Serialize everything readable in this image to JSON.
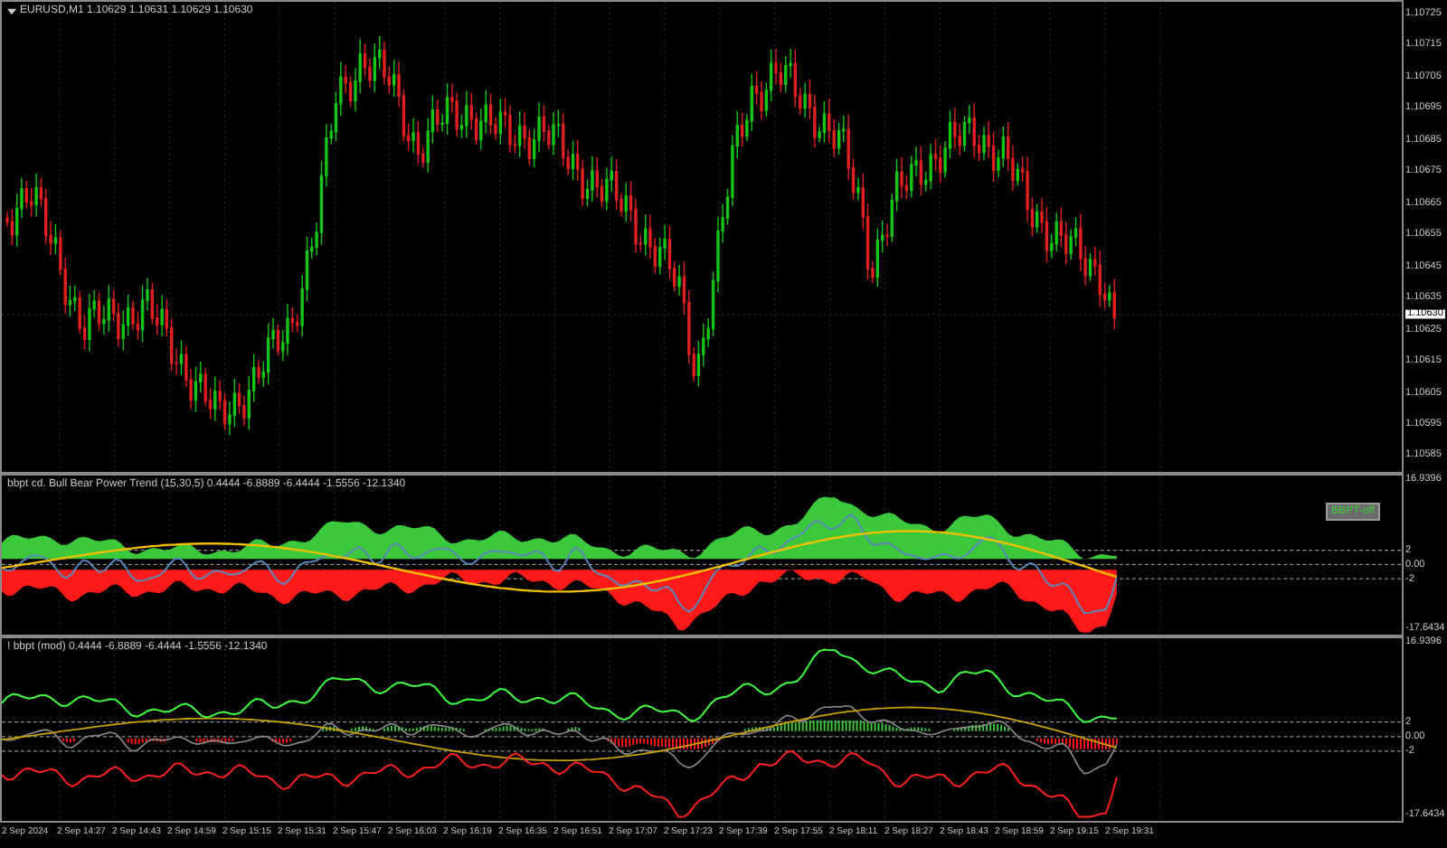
{
  "chart": {
    "title": "EURUSD,M1  1.10629 1.10631 1.10629 1.10630",
    "price_axis": [
      "1.10725",
      "1.10715",
      "1.10705",
      "1.10695",
      "1.10685",
      "1.10675",
      "1.10665",
      "1.10655",
      "1.10645",
      "1.10635",
      "1.10625",
      "1.10615",
      "1.10605",
      "1.10595",
      "1.10585"
    ],
    "current_price": "1.10630"
  },
  "indicator_1": {
    "title": "bbpt cd. Bull Bear Power Trend (15,30,5) 0.4444 -6.8889 -6.4444 -1.5556 -12.1340",
    "button": "BBPT-off",
    "axis": [
      "16.9396",
      "2",
      "0.00",
      "-2",
      "-17.6434"
    ]
  },
  "indicator_2": {
    "title": "! bbpt (mod) 0.4444 -6.8889 -6.4444 -1.5556 -12.1340",
    "axis": [
      "16.9396",
      "2",
      "0.00",
      "-2",
      "-17.6434"
    ]
  },
  "time_axis": [
    "2 Sep 2024",
    "2 Sep 14:27",
    "2 Sep 14:43",
    "2 Sep 14:59",
    "2 Sep 15:15",
    "2 Sep 15:31",
    "2 Sep 15:47",
    "2 Sep 16:03",
    "2 Sep 16:19",
    "2 Sep 16:35",
    "2 Sep 16:51",
    "2 Sep 17:07",
    "2 Sep 17:23",
    "2 Sep 17:39",
    "2 Sep 17:55",
    "2 Sep 18:11",
    "2 Sep 18:27",
    "2 Sep 18:43",
    "2 Sep 18:59",
    "2 Sep 19:15",
    "2 Sep 19:31"
  ]
}
